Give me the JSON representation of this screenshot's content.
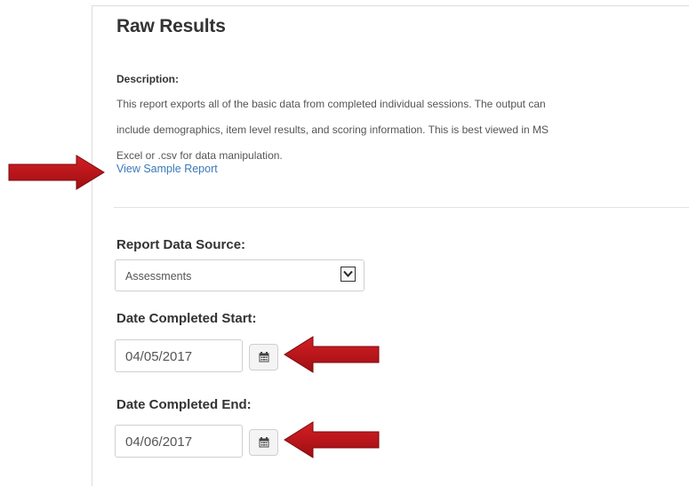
{
  "page": {
    "title": "Raw Results"
  },
  "description": {
    "label": "Description:",
    "lines": [
      "This report exports all of the basic data from completed individual sessions. The output can",
      "include demographics, item level results, and scoring information. This is best viewed in MS",
      "Excel or .csv for data manipulation."
    ],
    "sample_link": "View Sample Report"
  },
  "form": {
    "data_source": {
      "label": "Report Data Source:",
      "value": "Assessments"
    },
    "date_start": {
      "label": "Date Completed Start:",
      "value": "04/05/2017"
    },
    "date_end": {
      "label": "Date Completed End:",
      "value": "04/06/2017"
    }
  },
  "icons": {
    "calendar": "calendar-icon",
    "dropdown": "chevron-down-icon",
    "annotation": "red-arrow"
  },
  "colors": {
    "link": "#3a7ab8",
    "annotation_arrow": "#c0151b"
  }
}
